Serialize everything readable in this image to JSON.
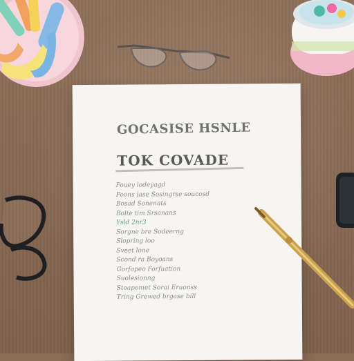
{
  "scene": {
    "description_tag": "",
    "paper": {
      "heading_top": "GOCASISE HSNLE",
      "heading_main": "TOK COVADE",
      "list_lines": [
        "Fouey lodeyagd",
        "Foons iase Sosingrse soucosd",
        "Bosad Sonenats",
        "Bolte tim Srsanans",
        "Ysld 2nr3",
        "Sorgne bre Sodeerng",
        "Slopring loo",
        "Sveet lone",
        "Scond ra Boyoans",
        "Gorfopeo Forfuation",
        "Suolesionng",
        "Stoapomet Sorai Eruonss",
        "Tring Grewed brgase bill"
      ]
    },
    "colors": {
      "desk": "#8a6c56",
      "paper": "#f6f5f2",
      "ink": "#7a7b7a",
      "accent_ink": "#5f9a8f",
      "pen_gold": "#d9b25a",
      "bowl_pink": "#f4c7cf"
    }
  }
}
